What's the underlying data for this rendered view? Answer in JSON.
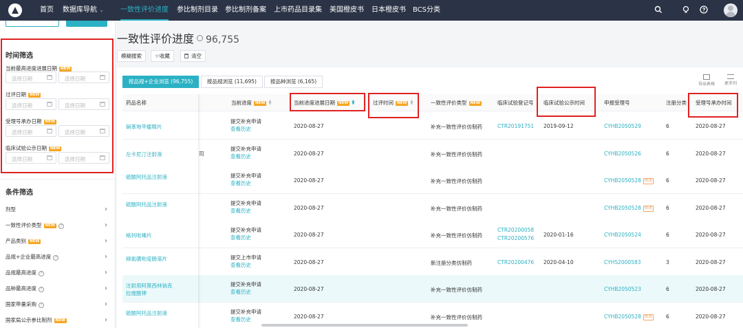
{
  "nav": {
    "items": [
      "首页",
      "数据库导航",
      "一致性评价进度",
      "参比制剂目录",
      "参比制剂备案",
      "上市药品目录集",
      "美国橙皮书",
      "日本橙皮书",
      "BCS分类"
    ],
    "active_index": 2,
    "dropdown_caret": "⌄",
    "icons": [
      "search-icon",
      "bulb-icon",
      "help-icon",
      "avatar"
    ]
  },
  "sidebar": {
    "time_title": "时间筛选",
    "time_filters": [
      {
        "label": "当前最高进度进展日期",
        "new": "NEW"
      },
      {
        "label": "过评日期",
        "new": "NEW"
      },
      {
        "label": "受理号承办日期",
        "new": "NEW"
      },
      {
        "label": "临床试验公示日期",
        "new": "NEW"
      }
    ],
    "date_placeholder": "选择日期",
    "cond_title": "条件筛选",
    "cond_items": [
      {
        "label": "剂型",
        "new": "",
        "help": false
      },
      {
        "label": "一致性评价类型",
        "new": "NEW",
        "help": true
      },
      {
        "label": "产品类别",
        "new": "NEW",
        "help": false
      },
      {
        "label": "品规+企业最高进度",
        "new": "",
        "help": true
      },
      {
        "label": "品规最高进度",
        "new": "",
        "help": true
      },
      {
        "label": "品种最高进度",
        "new": "",
        "help": true
      },
      {
        "label": "国家带量采购",
        "new": "",
        "help": true
      },
      {
        "label": "国家局公示参比制剂",
        "new": "NEW",
        "help": false
      }
    ]
  },
  "header": {
    "title": "一致性评价进度",
    "count": "96,755"
  },
  "toolbar": {
    "fuzzy": "模糊搜索",
    "favorite": "☆收藏",
    "clear": "清空"
  },
  "tabs": [
    {
      "label": "按品规+企业浏览 (96,755)",
      "active": true
    },
    {
      "label": "按品规浏览 (11,695)",
      "active": false
    },
    {
      "label": "按品种浏览 (6,165)",
      "active": false
    }
  ],
  "right_tools": {
    "export": "导出表格",
    "more": "更多列"
  },
  "table": {
    "columns": [
      "药品名称",
      "当前进度",
      "当前进度进展日期",
      "过评时间",
      "一致性评价类型",
      "临床试验登记号",
      "临床试验公示时间",
      "申报受理号",
      "注册分类",
      "受理号承办时间"
    ],
    "new_label": "NEW",
    "mod_tag": "修改",
    "rows": [
      {
        "name": "硝苯地平缓释片",
        "stage": "提交补充申请",
        "history": "查看历史",
        "date": "2020-08-27",
        "pass": "",
        "type": "补充一致性评价仿制药",
        "ct": [
          "CTR20191751"
        ],
        "ct_date": "2019-09-12",
        "acc": "CYHB2050529",
        "mod": false,
        "reg": "6",
        "acc_date": "2020-08-27"
      },
      {
        "name": "左卡尼汀注射液",
        "stage": "提交补充申请",
        "history": "查看历史",
        "date": "2020-08-27",
        "pass": "",
        "type": "补充一致性评价仿制药",
        "ct": [],
        "ct_date": "",
        "acc": "CYHB2050526",
        "mod": false,
        "reg": "6",
        "acc_date": "2020-08-27"
      },
      {
        "name": "硫酸阿托品注射液",
        "stage": "提交补充申请",
        "history": "查看历史",
        "date": "2020-08-27",
        "pass": "",
        "type": "补充一致性评价仿制药",
        "ct": [],
        "ct_date": "",
        "acc": "CYHB2050528",
        "mod": true,
        "reg": "6",
        "acc_date": "2020-08-27"
      },
      {
        "name": "硫酸阿托品注射液",
        "stage": "提交补充申请",
        "history": "查看历史",
        "date": "2020-08-27",
        "pass": "",
        "type": "补充一致性评价仿制药",
        "ct": [],
        "ct_date": "",
        "acc": "CYHB2050528",
        "mod": true,
        "reg": "6",
        "acc_date": "2020-08-27"
      },
      {
        "name": "格列吡嗪片",
        "stage": "提交补充申请",
        "history": "查看历史",
        "date": "2020-08-27",
        "pass": "",
        "type": "补充一致性评价仿制药",
        "ct": [
          "CTR20200058",
          "CTR20200576"
        ],
        "ct_date": "2020-01-16",
        "acc": "CYHB2050524",
        "mod": false,
        "reg": "6",
        "acc_date": "2020-08-27"
      },
      {
        "name": "柳氮磺吡啶肠溶片",
        "stage": "提交上市申请",
        "history": "查看历史",
        "date": "2020-08-27",
        "pass": "",
        "type": "新注册分类仿制药",
        "ct": [
          "CTR20200476"
        ],
        "ct_date": "2020-04-10",
        "acc": "CYHS2000583",
        "mod": false,
        "reg": "3",
        "acc_date": "2020-08-27"
      },
      {
        "name": "注射用阿莫西林钠克拉维酸钾",
        "stage": "提交补充申请",
        "history": "查看历史",
        "date": "2020-08-27",
        "pass": "",
        "type": "补充一致性评价仿制药",
        "ct": [],
        "ct_date": "",
        "acc": "CYHB2050523",
        "mod": false,
        "reg": "6",
        "acc_date": "2020-08-27"
      },
      {
        "name": "硫酸阿托品注射液",
        "stage": "提交补充申请",
        "history": "查看历史",
        "date": "2020-08-27",
        "pass": "",
        "type": "补充一致性评价仿制药",
        "ct": [],
        "ct_date": "",
        "acc": "CYHB2050528",
        "mod": true,
        "reg": "6",
        "acc_date": "2020-08-27"
      }
    ],
    "obscured_suffix": "司"
  },
  "colors": {
    "nav_bg": "#2b3346",
    "accent": "#2bb1c3",
    "highlight_box": "#e02020",
    "new_badge": "#f5a623"
  }
}
